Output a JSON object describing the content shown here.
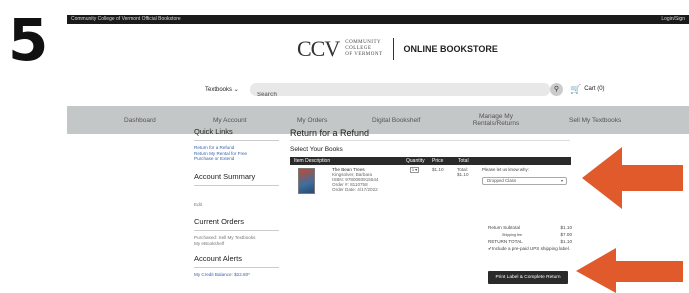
{
  "step": {
    "number": "5"
  },
  "topbar": {
    "left": "Community College of Vermont Official Bookstore",
    "right": "Login/Sign"
  },
  "brand": {
    "logo": "CCV",
    "college_line1": "COMMUNITY",
    "college_line2": "COLLEGE",
    "college_line3": "OF VERMONT",
    "store": "ONLINE BOOKSTORE"
  },
  "search": {
    "dropdown_label": "Textbooks",
    "placeholder": "Search",
    "cart_label": "Cart (0)"
  },
  "nav": {
    "items": [
      "Dashboard",
      "My Account",
      "My Orders",
      "Digital Bookshelf",
      "Manage My Rentals/Returns",
      "Sell My Textbooks"
    ]
  },
  "sidebar": {
    "quick_links_title": "Quick Links",
    "quick_links": [
      "Return for a Refund",
      "Return My Rental for Free",
      "Purchase or Extend"
    ],
    "account_summary_title": "Account Summary",
    "edit_label": "Edit",
    "current_orders_title": "Current Orders",
    "current_orders": [
      "Purchased: Sell My Textbooks",
      "My eBookshelf"
    ],
    "account_alerts_title": "Account Alerts",
    "credit_balance": "My Credit Balance: $22.80*"
  },
  "main": {
    "title": "Return for a Refund",
    "subtitle": "Select Your Books",
    "table_headers": {
      "description": "Item Description",
      "quantity": "Quantity",
      "price": "Price",
      "total": "Total"
    },
    "book": {
      "title": "The Bean Trees",
      "author": "Kingsolver, Barbara",
      "isbn": "ISBN: 9780060915544",
      "order": "Order #: 8110758",
      "order_date": "Order Date: 4/17/2022",
      "quantity": "1",
      "price": "$1.10",
      "total_label": "Total:",
      "total_value": "$1.10"
    },
    "reason_prompt": "Please let us know why:",
    "reason_selected": "Dropped Class"
  },
  "summary": {
    "subtotal_label": "Return Subtotal",
    "subtotal_value": "$1.10",
    "shipping_label": "Shipping fee",
    "shipping_value": "$7.00",
    "total_label": "RETURN TOTAL",
    "total_value": "$1.10",
    "checkbox_label": "Include a pre-paid UPS shipping label.",
    "button_label": "Print Label & Complete Return"
  },
  "colors": {
    "arrow": "#e15a2c",
    "nav_bg": "#c3c7c7",
    "link": "#3a64a8"
  }
}
